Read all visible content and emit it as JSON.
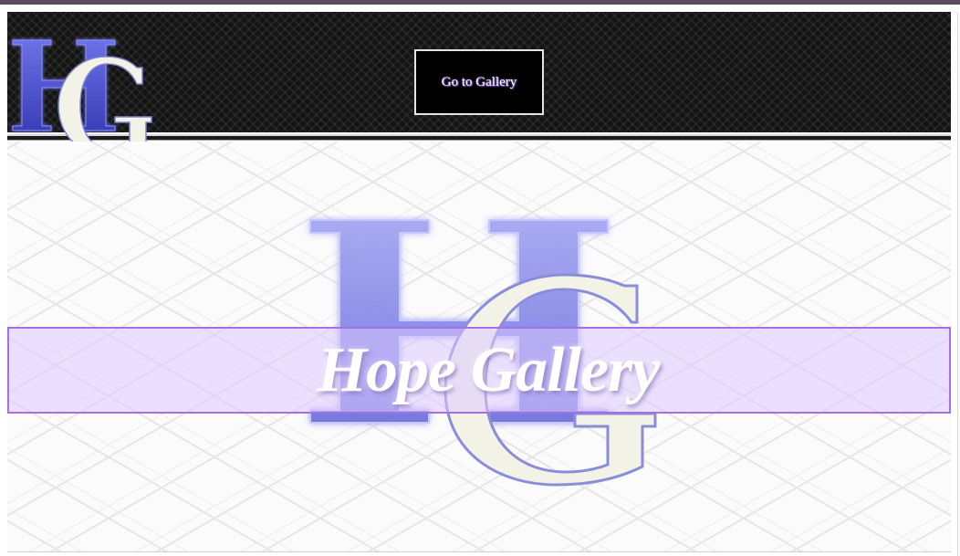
{
  "header": {
    "logo_letters": "HG",
    "gallery_button_label": "Go to Gallery"
  },
  "hero": {
    "logo_letters": "HG",
    "title": "Hope Gallery"
  },
  "colors": {
    "top_strip": "#5e4a60",
    "header_bg": "#141414",
    "logo_h": "#4a4fd0",
    "logo_g": "#f2f3e6",
    "title_band": "#dcc8ff",
    "title_band_border": "#a86ee6"
  }
}
